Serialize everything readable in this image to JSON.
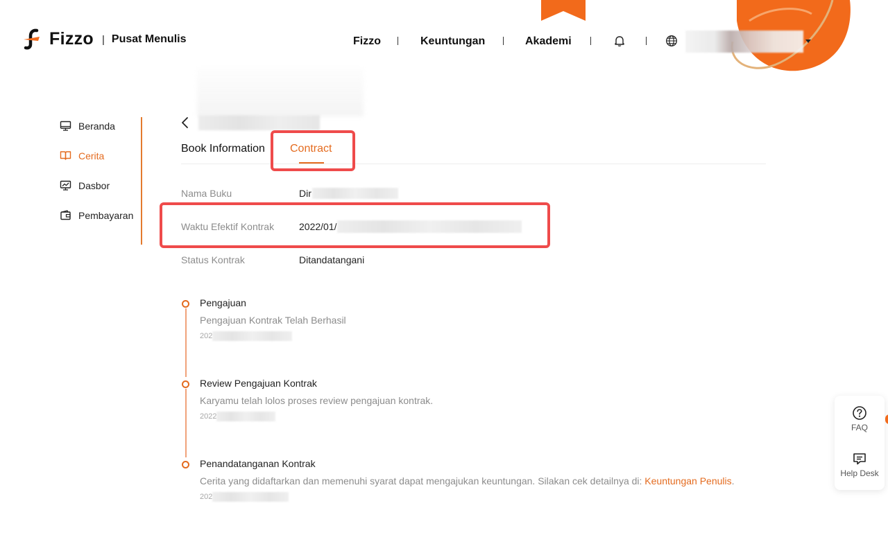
{
  "header": {
    "brand": "Fizzo",
    "separator": "|",
    "subtitle": "Pusat Menulis",
    "nav": [
      "Fizzo",
      "Keuntungan",
      "Akademi"
    ],
    "icons": [
      "bell-icon",
      "globe-icon",
      "chevron-down-icon"
    ]
  },
  "sidebar": {
    "items": [
      {
        "label": "Beranda",
        "icon": "monitor-icon",
        "active": false
      },
      {
        "label": "Cerita",
        "icon": "book-open-icon",
        "active": true
      },
      {
        "label": "Dasbor",
        "icon": "chart-monitor-icon",
        "active": false
      },
      {
        "label": "Pembayaran",
        "icon": "wallet-icon",
        "active": false
      }
    ]
  },
  "tabs": {
    "book_information": "Book Information",
    "contract": "Contract",
    "active": "Contract"
  },
  "contract_info": {
    "book_name_label": "Nama Buku",
    "book_name_value": "Dir",
    "effective_time_label": "Waktu Efektif Kontrak",
    "effective_time_value": "2022/01/",
    "status_label": "Status Kontrak",
    "status_value": "Ditandatangani"
  },
  "timeline": [
    {
      "title": "Pengajuan",
      "desc": "Pengajuan Kontrak Telah Berhasil",
      "date": "202"
    },
    {
      "title": "Review Pengajuan Kontrak",
      "desc": "Karyamu telah lolos proses review pengajuan kontrak.",
      "date": "2022"
    },
    {
      "title": "Penandatanganan Kontrak",
      "desc": "Cerita yang didaftarkan dan memenuhi syarat dapat mengajukan keuntungan. Silakan cek detailnya di: ",
      "link": "Keuntungan Penulis",
      "link_suffix": ".",
      "date": "202"
    }
  ],
  "help_panel": {
    "faq": "FAQ",
    "help_desk": "Help Desk"
  },
  "colors": {
    "accent": "#e46b1f",
    "highlight": "#ef4b4b",
    "muted": "#8c8c8c"
  }
}
